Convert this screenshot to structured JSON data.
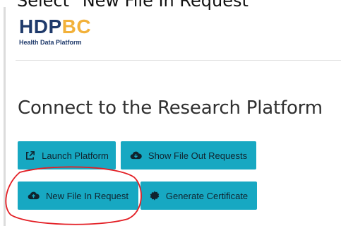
{
  "instruction": "Select \"New File In Request\"",
  "logo": {
    "primary": "HDP",
    "accent": "BC",
    "subtitle": "Health Data Platform"
  },
  "page": {
    "title": "Connect to the Research Platform"
  },
  "buttons": {
    "launch_platform": {
      "label": "Launch Platform",
      "icon": "external-link-icon"
    },
    "show_file_out_requests": {
      "label": "Show File Out Requests",
      "icon": "cloud-download-icon"
    },
    "new_file_in_request": {
      "label": "New File In Request",
      "icon": "cloud-upload-icon"
    },
    "generate_certificate": {
      "label": "Generate Certificate",
      "icon": "certificate-icon"
    }
  },
  "colors": {
    "button_bg": "#17a8c2",
    "logo_primary": "#1f3a6b",
    "logo_accent": "#f2b13a",
    "annotation": "#e31e24"
  }
}
